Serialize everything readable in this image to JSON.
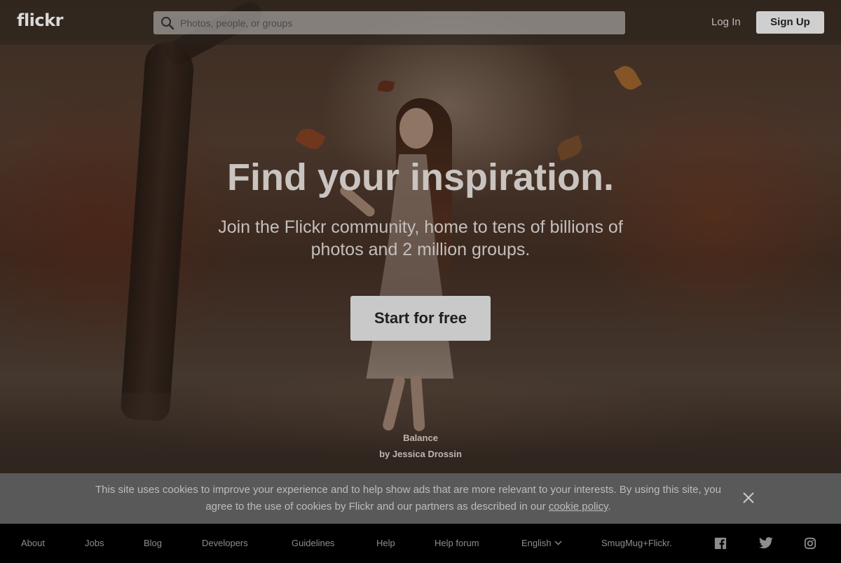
{
  "header": {
    "logo": "flickr",
    "search_placeholder": "Photos, people, or groups",
    "login_label": "Log In",
    "signup_label": "Sign Up"
  },
  "hero": {
    "headline": "Find your inspiration.",
    "subhead": "Join the Flickr community, home to tens of billions of photos and 2 million groups.",
    "cta_label": "Start for free",
    "photo_title": "Balance",
    "photo_author": "by Jessica Drossin"
  },
  "cookie_banner": {
    "text_before": "This site uses cookies to improve your experience and to help show ads that are more relevant to your interests. By using this site, you agree to the use of cookies by Flickr and our partners as described in our ",
    "link_label": "cookie policy",
    "text_after": "."
  },
  "footer": {
    "links": [
      "About",
      "Jobs",
      "Blog",
      "Developers",
      "Guidelines",
      "Help",
      "Help forum"
    ],
    "language": "English",
    "brand": "SmugMug+Flickr."
  },
  "icons": {
    "search": "search-icon",
    "close": "close-icon",
    "language_dropdown": "chevron-down-icon",
    "facebook": "facebook-icon",
    "twitter": "twitter-icon",
    "instagram": "instagram-icon"
  },
  "colors": {
    "footer_bg": "#000000",
    "cookie_bg": "#595959",
    "button_bg": "#c9c9c9"
  }
}
